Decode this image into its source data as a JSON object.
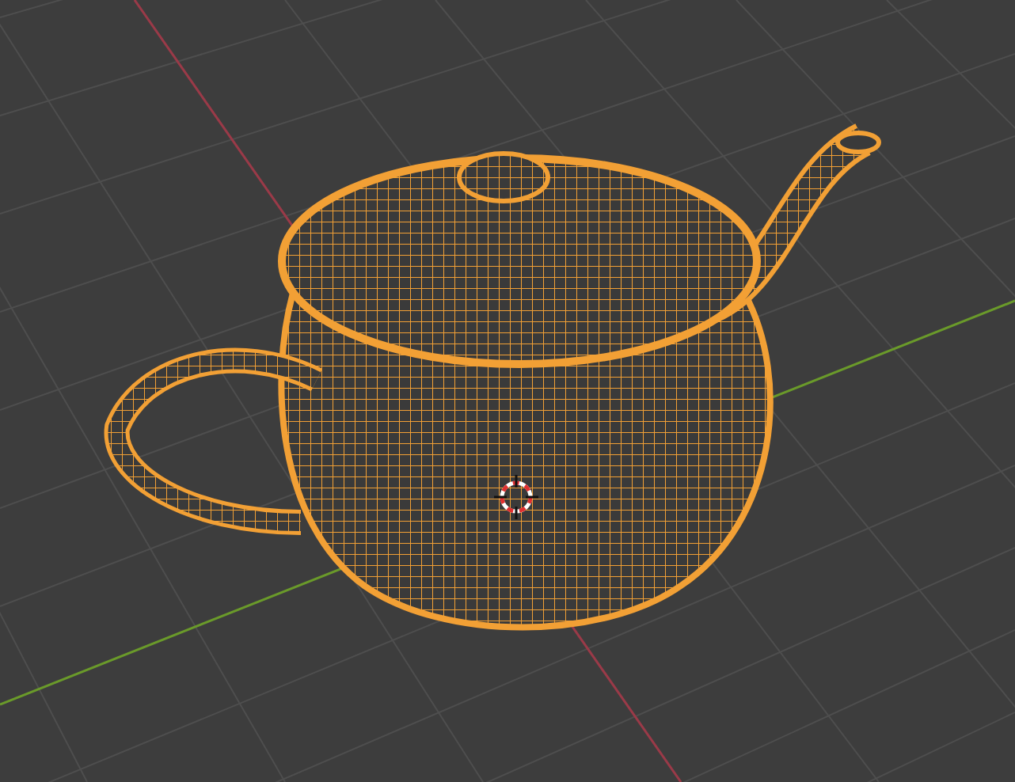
{
  "viewport": {
    "objects": [
      {
        "kind": "teapot",
        "selected": true
      }
    ]
  }
}
